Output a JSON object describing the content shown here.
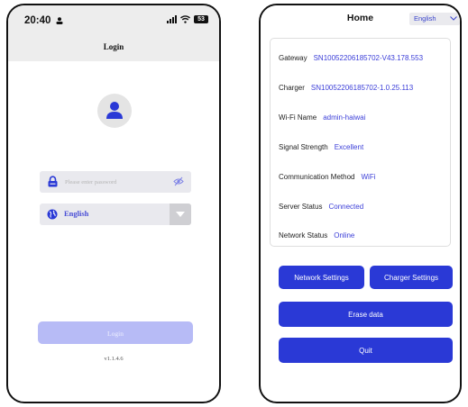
{
  "login_screen": {
    "status_bar": {
      "time": "20:40",
      "battery": "53"
    },
    "title": "Login",
    "password_placeholder": "Please enter password",
    "language": {
      "selected": "English"
    },
    "login_label": "Login",
    "version": "v1.1.4.6"
  },
  "home_screen": {
    "title": "Home",
    "language_selector": "English",
    "info": [
      {
        "label": "Gateway",
        "value": "SN10052206185702-V43.178.553"
      },
      {
        "label": "Charger",
        "value": "SN10052206185702-1.0.25.113"
      },
      {
        "label": "Wi-Fi Name",
        "value": "admin-haiwai"
      },
      {
        "label": "Signal Strength",
        "value": "Excellent"
      },
      {
        "label": "Communication Method",
        "value": "WiFi"
      },
      {
        "label": "Server Status",
        "value": "Connected"
      },
      {
        "label": "Network Status",
        "value": "Online"
      }
    ],
    "buttons": {
      "network_settings": "Network Settings",
      "charger_settings": "Charger Settings",
      "erase_data": "Erase data",
      "quit": "Quit"
    }
  },
  "colors": {
    "accent": "#2a39d6",
    "accent_disabled": "#b7bbf6",
    "value_text": "#3b3ed8",
    "bar_gray": "#ededed"
  }
}
